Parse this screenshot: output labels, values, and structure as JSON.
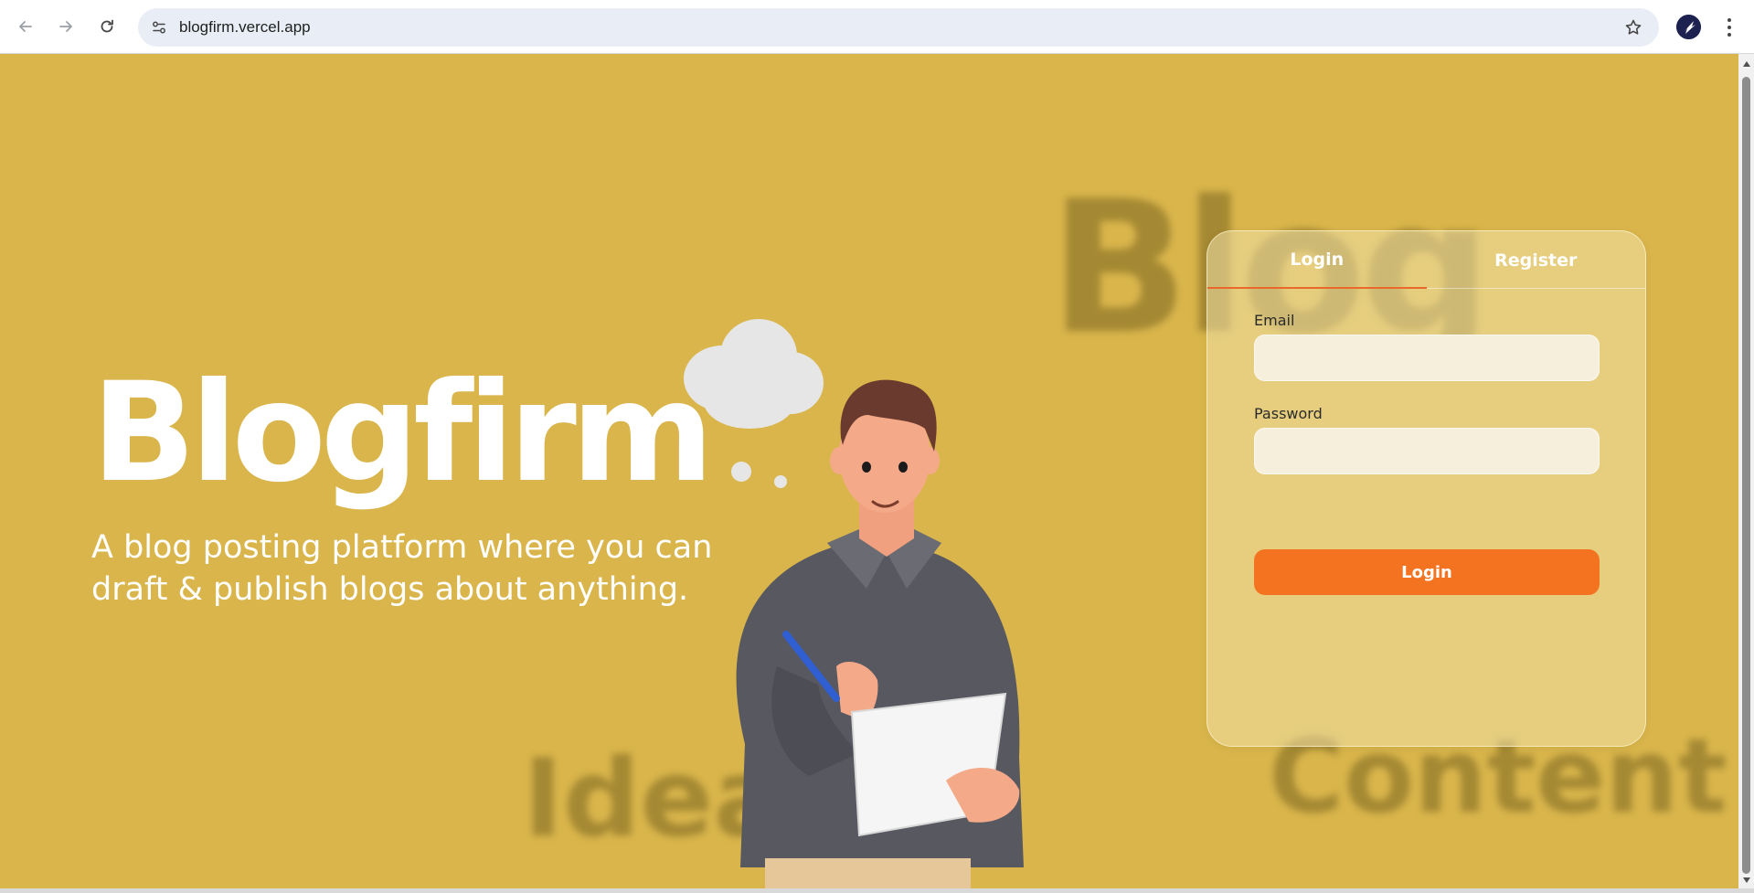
{
  "browser": {
    "url": "blogfirm.vercel.app",
    "back_icon": "back-arrow-icon",
    "forward_icon": "forward-arrow-icon",
    "reload_icon": "reload-icon",
    "site_info_icon": "tune-icon",
    "bookmark_icon": "star-icon",
    "menu_icon": "more-vert-icon"
  },
  "background_words": {
    "blog": "Blog",
    "idea": "Idea",
    "content": "Content"
  },
  "hero": {
    "title": "Blogfirm",
    "subtitle": "A blog posting platform where you can draft & publish blogs about anything."
  },
  "auth": {
    "tabs": [
      {
        "label": "Login",
        "active": true
      },
      {
        "label": "Register",
        "active": false
      }
    ],
    "email_label": "Email",
    "email_value": "",
    "password_label": "Password",
    "password_value": "",
    "submit_label": "Login"
  },
  "colors": {
    "page_background": "#d9b54b",
    "accent": "#f47320",
    "active_tab_underline": "#e8692b"
  }
}
